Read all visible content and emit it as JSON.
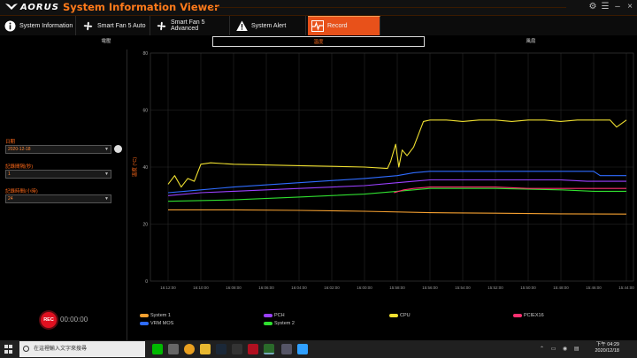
{
  "app": {
    "brand": "AORUS",
    "title": "System Information Viewer"
  },
  "window_controls": [
    "⚙",
    "☰",
    "–",
    "×"
  ],
  "tabs": [
    {
      "label": "System Information",
      "icon": "info-icon"
    },
    {
      "label": "Smart Fan 5 Auto",
      "icon": "fan-icon"
    },
    {
      "label": "Smart Fan 5 Advanced",
      "icon": "fan-icon"
    },
    {
      "label": "System Alert",
      "icon": "warning-icon"
    },
    {
      "label": "Record",
      "icon": "pulse-icon",
      "active": true
    }
  ],
  "subtabs": [
    {
      "label": "電壓"
    },
    {
      "label": "溫度",
      "active": true
    },
    {
      "label": "風扇"
    }
  ],
  "left": {
    "date_label": "日期",
    "date_value": "2020-12-18",
    "interval_label": "記錄間隔(秒)",
    "interval_value": "1",
    "duration_label": "記錄時間(小時)",
    "duration_value": "24",
    "rec_label": "REC",
    "rec_time": "00:00:00"
  },
  "colors": {
    "accent": "#e8511a",
    "system1": "#f5a030",
    "vrm_mos": "#2f6cff",
    "pch": "#9a40ff",
    "system2": "#30e030",
    "cpu": "#f0e030",
    "pciex16": "#ff3070"
  },
  "chart_data": {
    "type": "line",
    "ylabel": "溫度 (°C)",
    "ylim": [
      0,
      80
    ],
    "yticks": [
      0,
      20,
      40,
      60,
      80
    ],
    "xticks": [
      "16:12:00",
      "16:10:00",
      "16:08:00",
      "16:06:00",
      "16:04:00",
      "16:02:00",
      "16:00:00",
      "15:58:00",
      "15:56:00",
      "15:54:00",
      "15:52:00",
      "15:50:00",
      "15:48:00",
      "15:46:00",
      "15:44:00"
    ],
    "grid": true,
    "legend_position": "bottom",
    "series": [
      {
        "name": "System 1",
        "color": "#f5a030",
        "points": [
          [
            0,
            25
          ],
          [
            2,
            25
          ],
          [
            4,
            24.8
          ],
          [
            6,
            24.5
          ],
          [
            8,
            24
          ],
          [
            10,
            23.8
          ],
          [
            12,
            23.6
          ],
          [
            14,
            23.5
          ]
        ]
      },
      {
        "name": "VRM MOS",
        "color": "#2f6cff",
        "points": [
          [
            0,
            31
          ],
          [
            0.5,
            31.5
          ],
          [
            1,
            32
          ],
          [
            2,
            33
          ],
          [
            4,
            34.5
          ],
          [
            6,
            36
          ],
          [
            7,
            37
          ],
          [
            7.5,
            38
          ],
          [
            8,
            38.5
          ],
          [
            10,
            38.5
          ],
          [
            12,
            38.5
          ],
          [
            13,
            38.5
          ],
          [
            13.2,
            37
          ],
          [
            14,
            37
          ]
        ]
      },
      {
        "name": "PCH",
        "color": "#9a40ff",
        "points": [
          [
            0,
            30
          ],
          [
            1,
            31
          ],
          [
            2,
            31.5
          ],
          [
            4,
            32.5
          ],
          [
            6,
            33.5
          ],
          [
            7,
            34.5
          ],
          [
            7.5,
            35
          ],
          [
            8,
            35.5
          ],
          [
            12,
            35.5
          ],
          [
            12.8,
            35
          ],
          [
            14,
            35
          ]
        ]
      },
      {
        "name": "System 2",
        "color": "#30e030",
        "points": [
          [
            0,
            28
          ],
          [
            2,
            28.5
          ],
          [
            4,
            29.5
          ],
          [
            6,
            30.5
          ],
          [
            7,
            31.5
          ],
          [
            7.5,
            32
          ],
          [
            8,
            32.5
          ],
          [
            10,
            32.5
          ],
          [
            12,
            32
          ],
          [
            13,
            31.5
          ],
          [
            14,
            31.5
          ]
        ]
      },
      {
        "name": "CPU",
        "color": "#f0e030",
        "points": [
          [
            0,
            34
          ],
          [
            0.2,
            37
          ],
          [
            0.4,
            33
          ],
          [
            0.6,
            36
          ],
          [
            0.8,
            35
          ],
          [
            1,
            41
          ],
          [
            1.3,
            41.5
          ],
          [
            2,
            41
          ],
          [
            4,
            40.5
          ],
          [
            6,
            40
          ],
          [
            6.7,
            39.5
          ],
          [
            6.8,
            42
          ],
          [
            6.95,
            48
          ],
          [
            7.05,
            40
          ],
          [
            7.15,
            46
          ],
          [
            7.3,
            44
          ],
          [
            7.5,
            47
          ],
          [
            7.8,
            56
          ],
          [
            8,
            56.5
          ],
          [
            8.5,
            56.5
          ],
          [
            9,
            56
          ],
          [
            9.5,
            56.5
          ],
          [
            10,
            56.5
          ],
          [
            10.5,
            56
          ],
          [
            11,
            56.5
          ],
          [
            11.5,
            56.5
          ],
          [
            12,
            56
          ],
          [
            12.5,
            56.5
          ],
          [
            13,
            56.5
          ],
          [
            13.5,
            56.5
          ],
          [
            13.7,
            54
          ],
          [
            14,
            56.5
          ]
        ]
      },
      {
        "name": "PCIEX16",
        "color": "#ff3070",
        "points": [
          [
            6.9,
            31
          ],
          [
            7.2,
            32
          ],
          [
            7.5,
            32.5
          ],
          [
            8,
            33
          ],
          [
            10,
            33
          ],
          [
            11,
            32.5
          ],
          [
            12,
            32.5
          ],
          [
            14,
            32.5
          ]
        ]
      }
    ]
  },
  "legend": [
    {
      "name": "System 1",
      "color": "#f5a030"
    },
    {
      "name": "VRM MOS",
      "color": "#2f6cff"
    },
    {
      "name": "PCH",
      "color": "#9a40ff"
    },
    {
      "name": "System 2",
      "color": "#30e030"
    },
    {
      "name": "CPU",
      "color": "#f0e030"
    },
    {
      "name": "PCIEX16",
      "color": "#ff3070"
    }
  ],
  "taskbar": {
    "search_placeholder": "在這裡輸入文字來搜尋",
    "time": "下午 04:29",
    "date": "2020/12/18"
  }
}
